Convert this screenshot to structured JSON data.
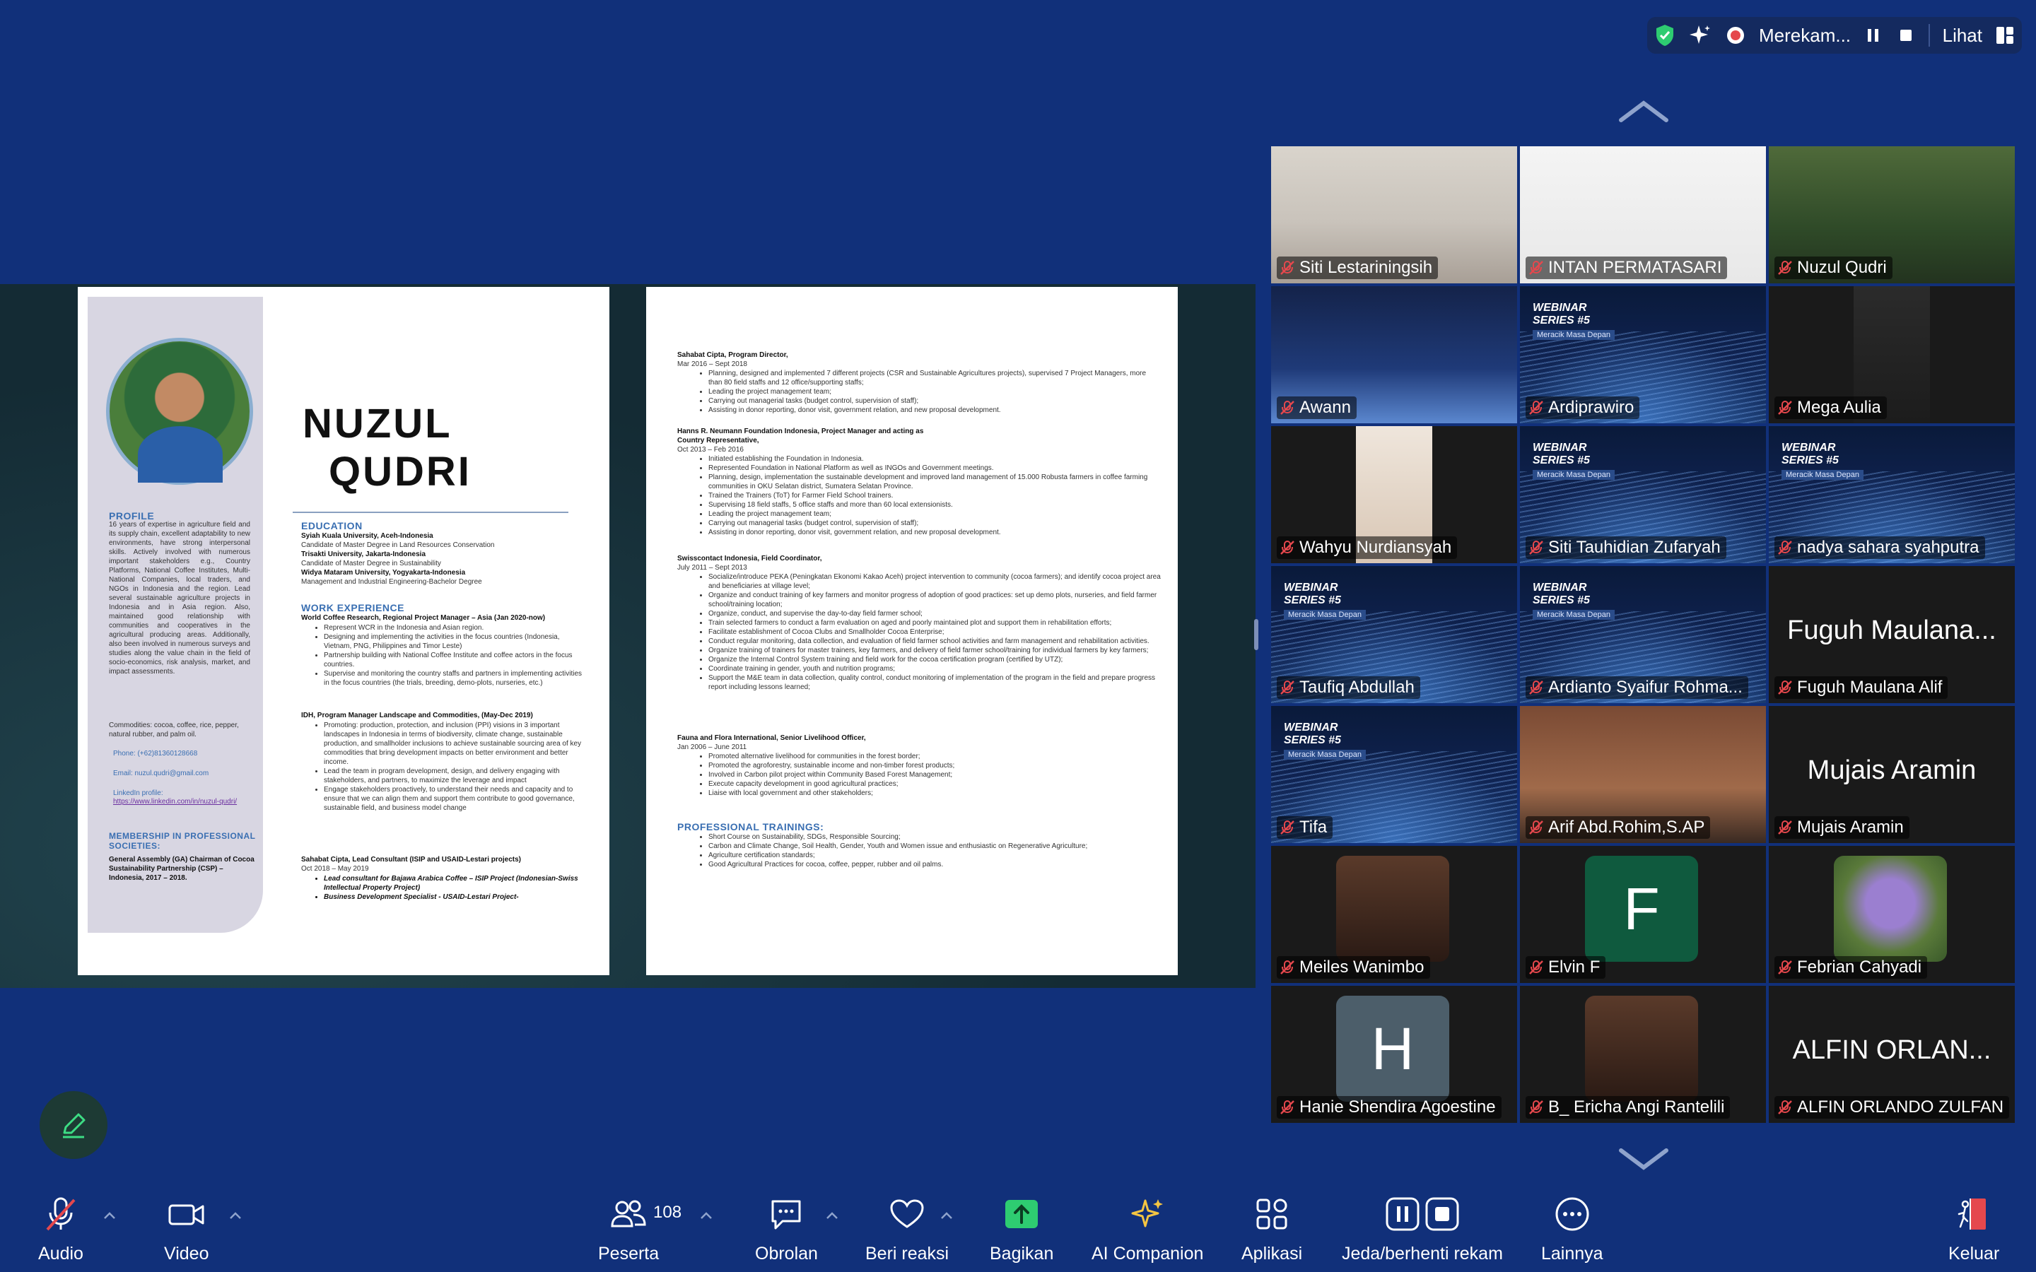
{
  "topbar": {
    "recording_label": "Merekam...",
    "view_label": "Lihat"
  },
  "resume": {
    "first_name": "NUZUL",
    "last_name": "QUDRI",
    "profile_title": "PROFILE",
    "profile_text": "16 years of expertise in agriculture field and its supply chain, excellent adaptability to new environments, have strong interpersonal skills. Actively involved with numerous important stakeholders e.g., Country Platforms, National Coffee Institutes, Multi-National Companies, local traders, and NGOs in Indonesia and the region. Lead several sustainable agriculture projects in Indonesia and in Asia region. Also, maintained good relationship with communities and cooperatives in the agricultural producing areas. Additionally, also been involved in numerous surveys and studies along the value chain in the field of socio-economics, risk analysis, market, and impact assessments.",
    "commodities": "Commodities: cocoa, coffee, rice, pepper, natural rubber, and palm oil.",
    "phone": "Phone: (+62)81360128668",
    "email": "Email: nuzul.qudri@gmail.com",
    "linkedin_label": "LinkedIn profile:",
    "linkedin_url": "https://www.linkedin.com/in/nuzul-qudri/",
    "membership_title": "MEMBERSHIP IN PROFESSIONAL SOCIETIES:",
    "membership_text": "General Assembly (GA) Chairman of Cocoa Sustainability Partnership (CSP) – Indonesia, 2017 – 2018.",
    "education_title": "EDUCATION",
    "education": [
      "Syiah Kuala University, Aceh-Indonesia",
      "Candidate of Master Degree in Land Resources Conservation",
      "Trisakti University, Jakarta-Indonesia",
      "Candidate of Master Degree in Sustainability",
      "Widya Mataram University, Yogyakarta-Indonesia",
      "Management and Industrial Engineering-Bachelor Degree"
    ],
    "work_title": "WORK EXPERIENCE",
    "work_1_head": "World Coffee Research, Regional Project Manager – Asia (Jan 2020-now)",
    "work_1_bullets": [
      "Represent WCR in the Indonesia and Asian region.",
      "Designing and implementing the activities in the focus countries (Indonesia, Vietnam, PNG, Philippines and Timor Leste)",
      "Partnership building with National Coffee Institute and coffee actors in the focus countries.",
      "Supervise and monitoring the country staffs and partners in implementing activities in the focus countries (the trials, breeding, demo-plots, nurseries, etc.)"
    ],
    "work_2_head": "IDH, Program Manager Landscape and Commodities, (May-Dec 2019)",
    "work_2_bullets": [
      "Promoting: production, protection, and inclusion (PPI) visions in 3 important landscapes in Indonesia in terms of biodiversity, climate change, sustainable production, and smallholder inclusions to achieve sustainable sourcing area of key commodities that bring development impacts on better environment and better income.",
      "Lead the team in program development, design, and delivery engaging with stakeholders, and partners, to maximize the leverage and impact",
      "Engage stakeholders proactively, to understand their needs and capacity and to ensure that we can align them and support them contribute to good governance, sustainable field, and business model change"
    ],
    "work_3_head": "Sahabat Cipta, Lead Consultant (ISIP and USAID-Lestari projects)",
    "work_3_date": "Oct 2018 – May 2019",
    "work_3_bullets": [
      "Lead consultant for Bajawa Arabica Coffee – ISIP Project (Indonesian-Swiss Intellectual Property Project)",
      "Business Development Specialist - USAID-Lestari Project-"
    ],
    "p2_1_head": "Sahabat Cipta, Program Director,",
    "p2_1_date": "Mar 2016 – Sept 2018",
    "p2_1_bullets": [
      "Planning, designed and implemented 7 different projects (CSR and Sustainable Agricultures projects), supervised 7 Project Managers, more than 80 field staffs and 12 office/supporting staffs;",
      "Leading the project management team;",
      "Carrying out managerial tasks (budget control, supervision of staff);",
      "Assisting in donor reporting, donor visit, government relation, and new proposal development."
    ],
    "p2_2_head": "Hanns R. Neumann Foundation Indonesia, Project Manager and acting as Country Representative,",
    "p2_2_date": "Oct 2013 – Feb 2016",
    "p2_2_bullets": [
      "Initiated establishing the Foundation in Indonesia.",
      "Represented Foundation in National Platform as well as INGOs and Government meetings.",
      "Planning, design, implementation the sustainable development and improved land management of 15.000 Robusta farmers in coffee farming communities in OKU Selatan district, Sumatera Selatan Province.",
      "Trained the Trainers (ToT) for Farmer Field School trainers.",
      "Supervising 18 field staffs, 5 office staffs and more than 60 local extensionists.",
      "Leading the project management team;",
      "Carrying out managerial tasks (budget control, supervision of staff);",
      "Assisting in donor reporting, donor visit, government relation, and new proposal development."
    ],
    "p2_3_head": "Swisscontact Indonesia, Field Coordinator,",
    "p2_3_date": "July 2011 – Sept 2013",
    "p2_3_bullets": [
      "Socialize/introduce PEKA (Peningkatan Ekonomi Kakao Aceh) project intervention to community (cocoa farmers); and identify cocoa project area and beneficiaries at village level;",
      "Organize and conduct training of key farmers and monitor progress of adoption of good practices: set up demo plots, nurseries, and field farmer school/training location;",
      "Organize, conduct, and supervise the day-to-day field farmer school;",
      "Train selected farmers to conduct a farm evaluation on aged and poorly maintained plot and support them in rehabilitation efforts;",
      "Facilitate establishment of Cocoa Clubs and Smallholder Cocoa Enterprise;",
      "Conduct regular monitoring, data collection, and evaluation of field farmer school activities and farm management and rehabilitation activities.",
      "Organize training of trainers for master trainers, key farmers, and delivery of field farmer school/training for individual farmers by key farmers;",
      "Organize the Internal Control System training and field work for the cocoa certification program (certified by UTZ);",
      "Coordinate training in gender, youth and nutrition programs;",
      "Support the M&E team in data collection, quality control, conduct monitoring of implementation of the program in the field and prepare progress report including lessons learned;"
    ],
    "p2_4_head": "Fauna and Flora International, Senior Livelihood Officer,",
    "p2_4_date": "Jan 2006 – June 2011",
    "p2_4_bullets": [
      "Promoted alternative livelihood for communities in the forest border;",
      "Promoted the agroforestry, sustainable income and non-timber forest products;",
      "Involved in Carbon pilot project within Community Based Forest Management;",
      "Execute capacity development in good agricultural practices;",
      "Liaise with local government and other stakeholders;"
    ],
    "trainings_title": "PROFESSIONAL TRAININGS:",
    "trainings": [
      "Short Course on Sustainability, SDGs, Responsible Sourcing;",
      "Carbon and Climate Change, Soil Health, Gender, Youth and Women issue and enthusiastic on Regenerative Agriculture;",
      "Agriculture certification standards;",
      "Good Agricultural Practices for cocoa, coffee, pepper, rubber and oil palms."
    ]
  },
  "webinar": {
    "title_line1": "WEBINAR",
    "title_line2": "SERIES #5",
    "subtitle": "Meracik Masa Depan"
  },
  "participants": [
    {
      "name": "Siti Lestariningsih",
      "kind": "video"
    },
    {
      "name": "INTAN PERMATASARI",
      "kind": "video"
    },
    {
      "name": "Nuzul Qudri",
      "kind": "video"
    },
    {
      "name": "Awann",
      "kind": "video"
    },
    {
      "name": "Ardiprawiro",
      "kind": "webinar"
    },
    {
      "name": "Mega Aulia",
      "kind": "video"
    },
    {
      "name": "Wahyu Nurdiansyah",
      "kind": "video"
    },
    {
      "name": "Siti Tauhidian Zufaryah",
      "kind": "webinar"
    },
    {
      "name": "nadya sahara syahputra",
      "kind": "webinar"
    },
    {
      "name": "Taufiq Abdullah",
      "kind": "webinar"
    },
    {
      "name": "Ardianto Syaifur Rohma...",
      "kind": "webinar"
    },
    {
      "name": "Fuguh Maulana Alif",
      "kind": "name",
      "big": "Fuguh Maulana..."
    },
    {
      "name": "Tifa",
      "kind": "webinar"
    },
    {
      "name": "Arif Abd.Rohim,S.AP",
      "kind": "video"
    },
    {
      "name": "Mujais Aramin",
      "kind": "name",
      "big": "Mujais Aramin"
    },
    {
      "name": "Meiles Wanimbo",
      "kind": "photo"
    },
    {
      "name": "Elvin F",
      "kind": "letter",
      "letter": "F"
    },
    {
      "name": "Febrian Cahyadi",
      "kind": "photo"
    },
    {
      "name": "Hanie Shendira Agoestine",
      "kind": "letter",
      "letter": "H"
    },
    {
      "name": "B_ Ericha Angi Rantelili",
      "kind": "photo"
    },
    {
      "name": "ALFIN ORLANDO ZULFAN",
      "kind": "name",
      "big": "ALFIN ORLAN..."
    }
  ],
  "toolbar": {
    "audio": "Audio",
    "video": "Video",
    "participants": "Peserta",
    "participants_count": "108",
    "chat": "Obrolan",
    "react": "Beri reaksi",
    "share": "Bagikan",
    "ai": "AI Companion",
    "apps": "Aplikasi",
    "record": "Jeda/berhenti rekam",
    "more": "Lainnya",
    "leave": "Keluar"
  },
  "colors": {
    "background": "#11307a",
    "active_speaker": "#3bd16f",
    "share_green": "#2ecc71",
    "ai_yellow": "#f5c542",
    "leave_red": "#e5484d"
  }
}
